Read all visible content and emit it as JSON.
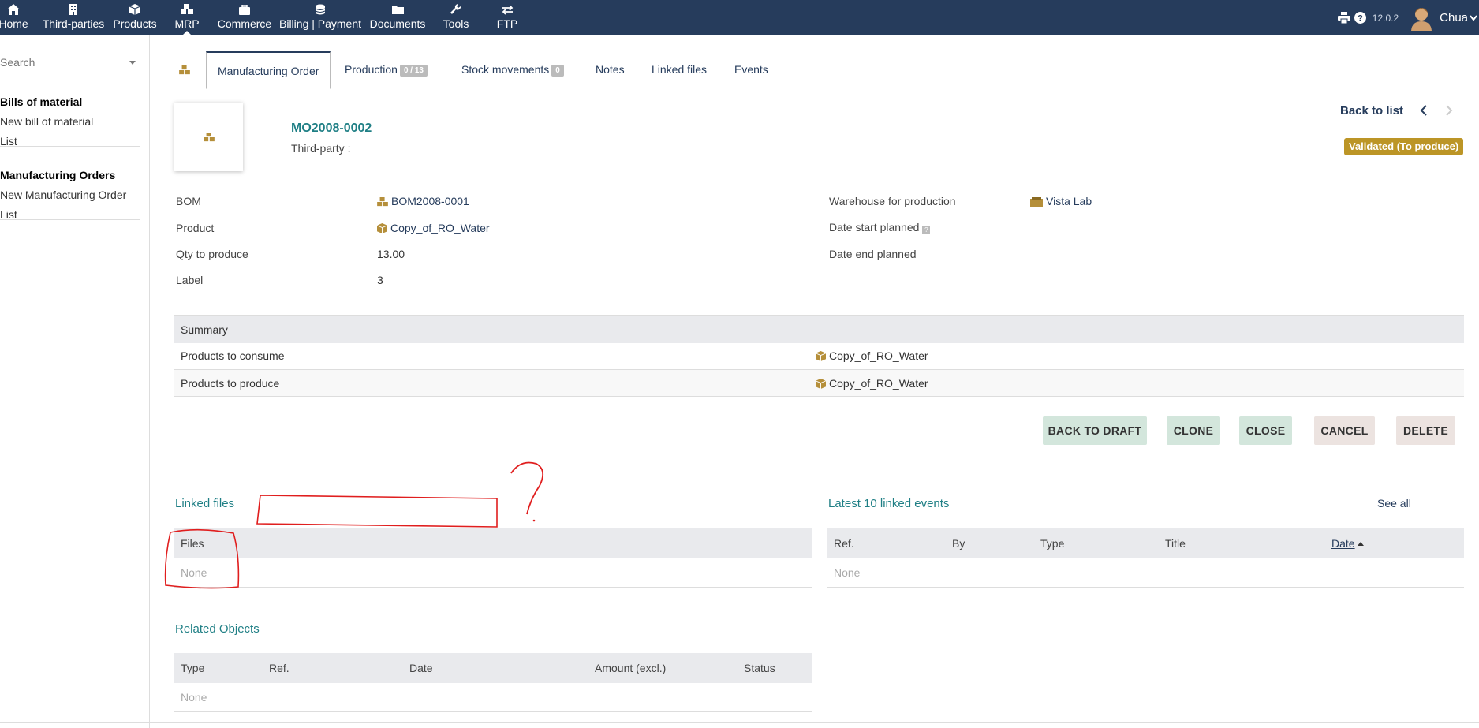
{
  "topbar": {
    "menu": [
      {
        "label": "Home",
        "icon": "home-icon"
      },
      {
        "label": "Third-parties",
        "icon": "building-icon"
      },
      {
        "label": "Products",
        "icon": "cube-icon"
      },
      {
        "label": "MRP",
        "icon": "cubes-icon",
        "active": true
      },
      {
        "label": "Commerce",
        "icon": "suitcase-icon"
      },
      {
        "label": "Billing | Payment",
        "icon": "coins-icon"
      },
      {
        "label": "Documents",
        "icon": "folder-icon"
      },
      {
        "label": "Tools",
        "icon": "wrench-icon"
      },
      {
        "label": "FTP",
        "icon": "exchange-icon"
      }
    ],
    "version": "12.0.2",
    "user": "Chua"
  },
  "sidebar": {
    "search_placeholder": "Search",
    "blocks": [
      {
        "title": "Bills of material",
        "links": [
          "New bill of material",
          "List"
        ]
      },
      {
        "title": "Manufacturing Orders",
        "links": [
          "New Manufacturing Order",
          "List"
        ]
      }
    ]
  },
  "tabs": [
    {
      "label": "Manufacturing Order",
      "active": true
    },
    {
      "label": "Production",
      "badge": "0 / 13"
    },
    {
      "label": "Stock movements",
      "badge": "0"
    },
    {
      "label": "Notes"
    },
    {
      "label": "Linked files"
    },
    {
      "label": "Events"
    }
  ],
  "header": {
    "ref": "MO2008-0002",
    "thirdparty_label": "Third-party :",
    "back_to_list": "Back to list",
    "status": "Validated (To produce)"
  },
  "fields_left": [
    {
      "key": "BOM",
      "value": "BOM2008-0001",
      "link": true,
      "icon": "cubes-icon"
    },
    {
      "key": "Product",
      "value": "Copy_of_RO_Water",
      "link": true,
      "icon": "cube-icon"
    },
    {
      "key": "Qty to produce",
      "value": "13.00"
    },
    {
      "key": "Label",
      "value": "3"
    }
  ],
  "fields_right": [
    {
      "key": "Warehouse for production",
      "value": "Vista Lab",
      "link": true,
      "icon": "box-icon"
    },
    {
      "key": "Date start planned",
      "value": ""
    },
    {
      "key": "Date end planned",
      "value": ""
    }
  ],
  "summary": {
    "header": "Summary",
    "rows": [
      {
        "label": "Products to consume",
        "value": "Copy_of_RO_Water"
      },
      {
        "label": "Products to produce",
        "value": "Copy_of_RO_Water"
      }
    ]
  },
  "actions": [
    "BACK TO DRAFT",
    "CLONE",
    "CLOSE",
    "CANCEL",
    "DELETE"
  ],
  "linked_files": {
    "title": "Linked files",
    "column": "Files",
    "empty": "None"
  },
  "events": {
    "title": "Latest 10 linked events",
    "see_all": "See all",
    "columns": [
      "Ref.",
      "By",
      "Type",
      "Title",
      "Date"
    ],
    "empty": "None"
  },
  "related": {
    "title": "Related Objects",
    "columns": [
      "Type",
      "Ref.",
      "Date",
      "Amount (excl.)",
      "Status"
    ],
    "empty": "None"
  },
  "colors": {
    "topbar": "#263c5c",
    "accent_teal": "#1f7f85",
    "status_bg": "#bc9526",
    "annotation": "#e01e1e"
  }
}
